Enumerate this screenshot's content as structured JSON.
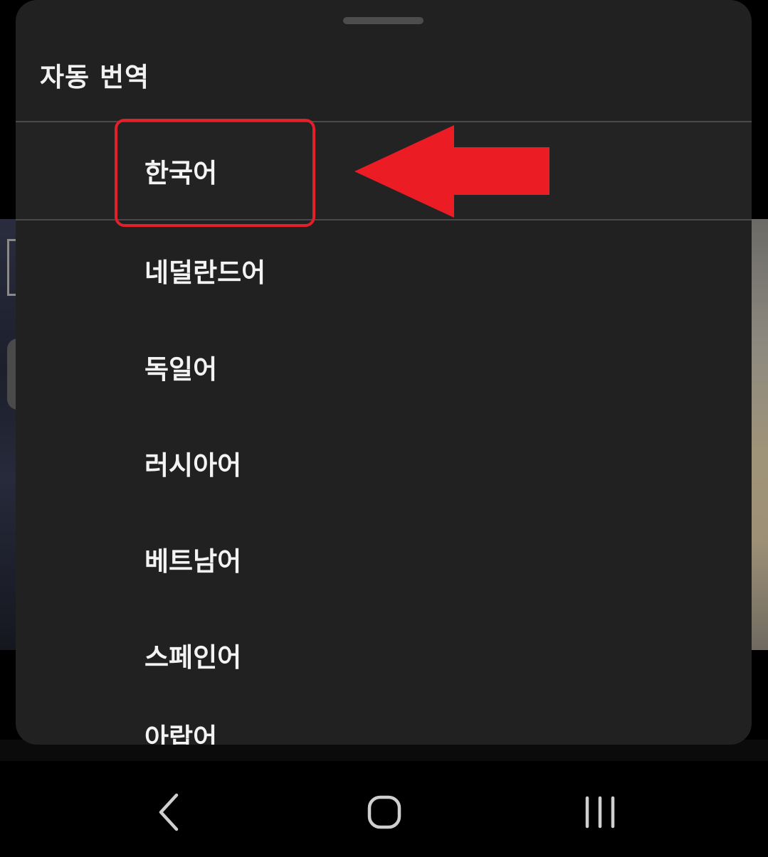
{
  "sheet": {
    "title": "자동 번역",
    "languages": [
      {
        "label": "한국어",
        "selected": true
      },
      {
        "label": "네덜란드어",
        "selected": false
      },
      {
        "label": "독일어",
        "selected": false
      },
      {
        "label": "러시아어",
        "selected": false
      },
      {
        "label": "베트남어",
        "selected": false
      },
      {
        "label": "스페인어",
        "selected": false
      },
      {
        "label": "아랍어",
        "selected": false
      }
    ]
  },
  "annotation": {
    "highlight_color": "#e21f2a",
    "arrow_color": "#ec1c24",
    "arrow_direction": "left"
  },
  "navbar": {
    "back_icon": "chevron-left-icon",
    "home_icon": "rounded-square-icon",
    "recents_icon": "three-bars-icon"
  },
  "colors": {
    "sheet_background": "#212121",
    "text": "#f3f3f3",
    "divider": "#4a4a4a"
  }
}
